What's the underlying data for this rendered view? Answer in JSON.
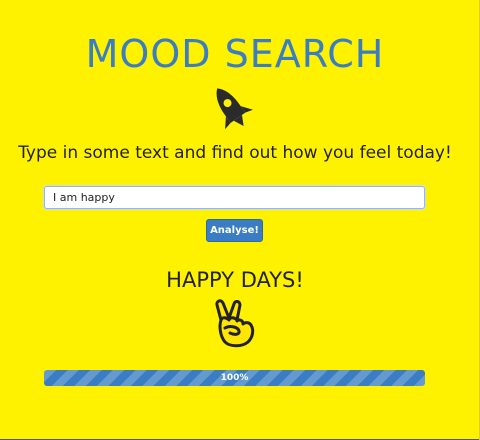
{
  "header": {
    "title": "MOOD SEARCH",
    "logo_icon": "rocket-icon"
  },
  "prompt": {
    "text": "Type in some text and find out how you feel today!"
  },
  "search": {
    "value": "I am happy",
    "placeholder": ""
  },
  "actions": {
    "analyse_label": "Analyse!"
  },
  "result": {
    "mood_text": "HAPPY DAYS!",
    "mood_icon": "peace-hand-icon"
  },
  "progress": {
    "value_percent": 100,
    "label": "100%"
  },
  "colors": {
    "background": "#fff200",
    "accent": "#3a7dc2",
    "text": "#222222",
    "hand_fill": "#ffe600"
  }
}
